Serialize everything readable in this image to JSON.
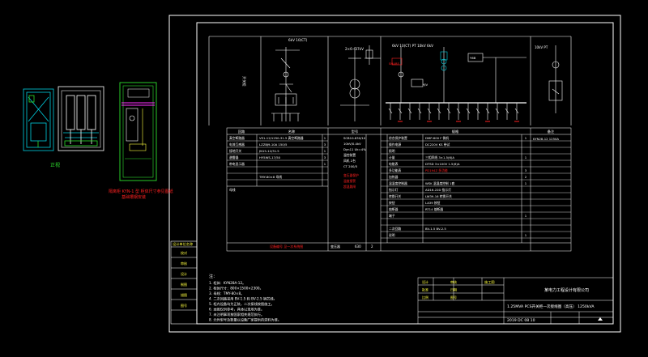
{
  "canvas": {
    "background": "#000000"
  },
  "colors": {
    "line": "#ffffff",
    "accent": "#ff2020",
    "cyan": "#00d0e0",
    "green": "#2ee02e",
    "magenta": "#ff30ff",
    "yellow": "#ffff40",
    "tint": "#a8a8ff"
  },
  "side_views": {
    "front_caption": "正视",
    "cabinet_note_line1": "隔离柜 KYN-1 型 柜体尺寸参见图纸",
    "cabinet_note_line2": "基础槽钢安装"
  },
  "diagram": {
    "bus_left": "6kV 10(CT)",
    "bus_middle": "2×6~37kV",
    "bus_right": "6kV 10(CT)  PT 10kV 6kV",
    "feeder_tag": "SHARE",
    "small_box_label": "Y6B",
    "cable_label": "YJV",
    "right_device": "10kV PT",
    "cubicle_label": "开关柜"
  },
  "main_table": {
    "headers": [
      "回路",
      "名称",
      "型号",
      "规格",
      "备注"
    ],
    "left_rows": [
      "真空断路器",
      "电流互感器",
      "接地开关",
      "避雷器",
      "带电显示器",
      "",
      "",
      "",
      "母线"
    ],
    "left_values": [
      "VS1-12/1250-31.5 真空断路器",
      "LZZBJ9-10A 150/5",
      "JN15-12/31.5",
      "HY5WS-17/50",
      "",
      "",
      "TMY-80×8 母线",
      ""
    ],
    "left_counts": [
      "1",
      "3",
      "1",
      "3",
      "1"
    ],
    "middle_lines": [
      "SCB10-630/10",
      "10kV/0.4kV",
      "Dyn11 Uk=4%",
      "温控装置",
      "风机 2台",
      "CT 200/5"
    ],
    "middle_red_lines": [
      "变压器保护",
      "温度报警",
      "超温跳闸"
    ],
    "middle_footer_label": "变压器",
    "middle_footer_value": "630",
    "middle_footer_count": "2",
    "right_rows": [
      "综合保护装置",
      "操作电源",
      "照明",
      "计量",
      "电能表",
      "多功能表",
      "加热器",
      "温湿度控制器",
      "指示灯",
      "转换开关",
      "按钮",
      "熔断器",
      "端子",
      "",
      "二次回路",
      "说明"
    ],
    "right_values": [
      "DMP-600 F 微机",
      "DC220V  KS 带试",
      "",
      "三相四线 3×1.5(6)A",
      "DTSD 3×100V 1.5(6)A",
      "PD194Z 多功能",
      "",
      "WSK 温湿度控制 1套",
      "AD16-22D 指示灯",
      "LW39-16 转换开关",
      "LA39 按钮",
      "RT14 熔断器",
      "",
      "",
      "BV-1.5 BV-2.5",
      ""
    ],
    "right_counts": [
      "1",
      "",
      "",
      "1",
      "",
      "3",
      "2",
      "1",
      "",
      "",
      "",
      "",
      "1",
      "",
      "",
      "1"
    ],
    "remarks_head": "KYN28-12 1250A",
    "bottom_red": "设备编号 见一次系统图"
  },
  "notes": {
    "title": "注：",
    "lines": [
      "1. 柜体：KYN28A-12。",
      "2. 柜体尺寸：800×1500×2300。",
      "3. 母线：TMY-80×8。",
      "4. 二次回路采用 BV-1.5 和 BV-2.5 铜芯线。",
      "5. 柜内设备均为正装，二次接线按图施工。",
      "6. 本图仅供参考，具体以现场为准。",
      "7. 未注明事项按国家相关规范执行。",
      "8. 元件型号及数量以设备厂家提供的资料为准。"
    ]
  },
  "left_strip": {
    "header": "设计单位名称",
    "cells": [
      "校对",
      "审核",
      "设计",
      "制图",
      "描图",
      "图号"
    ]
  },
  "title_block": {
    "company": "某电力工程设计有限公司",
    "drawing_title": "1.25MVA PCS开关柜一次接线图（高压）  1250kVA",
    "drawing_no": "2019 DC 08 10",
    "stage_label": "施工图",
    "cells": [
      "设计",
      "审核",
      "批准",
      "日期",
      "比例",
      "图号"
    ]
  }
}
